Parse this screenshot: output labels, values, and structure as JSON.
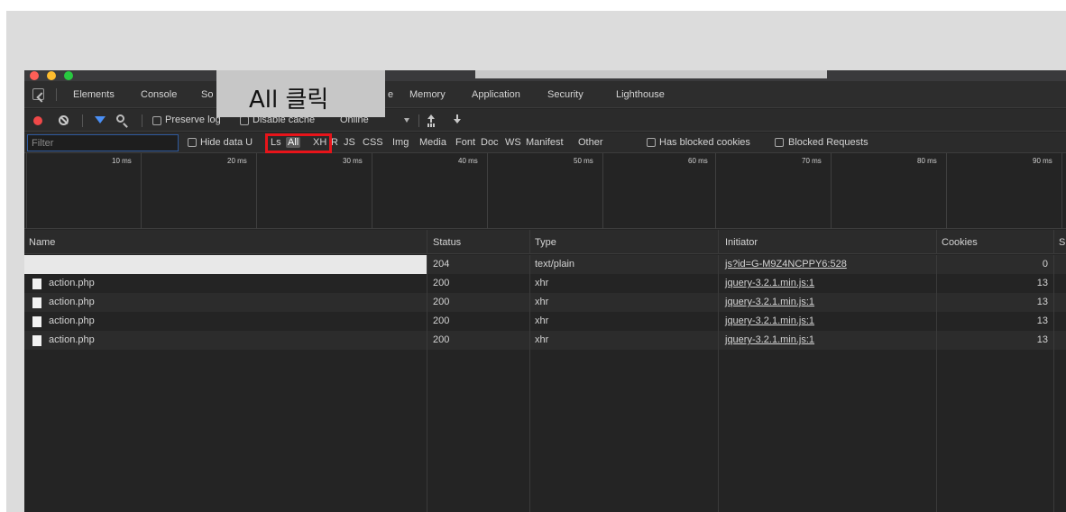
{
  "tabs": [
    "Elements",
    "Console",
    "So",
    "e",
    "Memory",
    "Application",
    "Security",
    "Lighthouse"
  ],
  "toolbar": {
    "preserve_log": "Preserve log",
    "disable_cache": "Disable cache",
    "online": "Online"
  },
  "filter": {
    "placeholder": "Filter",
    "hide_data_urls": "Hide data U",
    "types": [
      "Ls",
      "All",
      "XH",
      "R",
      "JS",
      "CSS",
      "Img",
      "Media",
      "Font",
      "Doc",
      "WS",
      "Manifest",
      "Other"
    ],
    "selected_type": "All",
    "has_blocked_cookies": "Has blocked cookies",
    "blocked_requests": "Blocked Requests"
  },
  "timeline": {
    "ticks": [
      "10 ms",
      "20 ms",
      "30 ms",
      "40 ms",
      "50 ms",
      "60 ms",
      "70 ms",
      "80 ms",
      "90 ms"
    ]
  },
  "table": {
    "columns": [
      "Name",
      "Status",
      "Type",
      "Initiator",
      "Cookies",
      "Si"
    ],
    "rows": [
      {
        "name": "",
        "status": "204",
        "type": "text/plain",
        "initiator": "js?id=G-M9Z4NCPPY6:528",
        "cookies": "0"
      },
      {
        "name": "action.php",
        "status": "200",
        "type": "xhr",
        "initiator": "jquery-3.2.1.min.js:1",
        "cookies": "13"
      },
      {
        "name": "action.php",
        "status": "200",
        "type": "xhr",
        "initiator": "jquery-3.2.1.min.js:1",
        "cookies": "13"
      },
      {
        "name": "action.php",
        "status": "200",
        "type": "xhr",
        "initiator": "jquery-3.2.1.min.js:1",
        "cookies": "13"
      },
      {
        "name": "action.php",
        "status": "200",
        "type": "xhr",
        "initiator": "jquery-3.2.1.min.js:1",
        "cookies": "13"
      }
    ]
  },
  "callout": {
    "text": "All 클릭"
  },
  "colors": {
    "callout_box": "#e8141a",
    "record": "#ef4848",
    "filter_accent": "#4a8ff5"
  }
}
